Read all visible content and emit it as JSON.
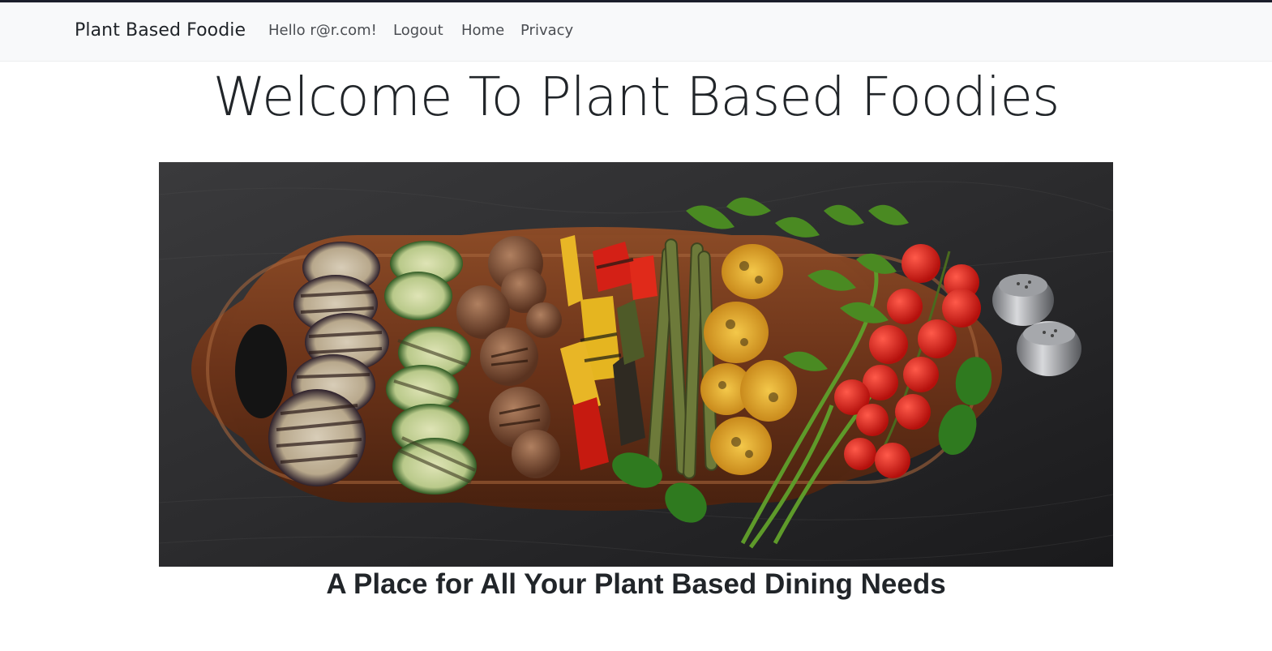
{
  "navbar": {
    "brand": "Plant Based Foodie",
    "greeting": "Hello r@r.com!",
    "links": [
      "Logout",
      "Home",
      "Privacy"
    ]
  },
  "main": {
    "title": "Welcome To Plant Based Foodies",
    "tagline": "A Place for All Your Plant Based Dining Needs"
  },
  "hero_image": {
    "subject": "grilled vegetables on a wooden serving board on a dark slate background"
  },
  "colors": {
    "navbar_bg": "#f8f9fa",
    "top_border": "#1b1e2b",
    "text": "#212529"
  }
}
